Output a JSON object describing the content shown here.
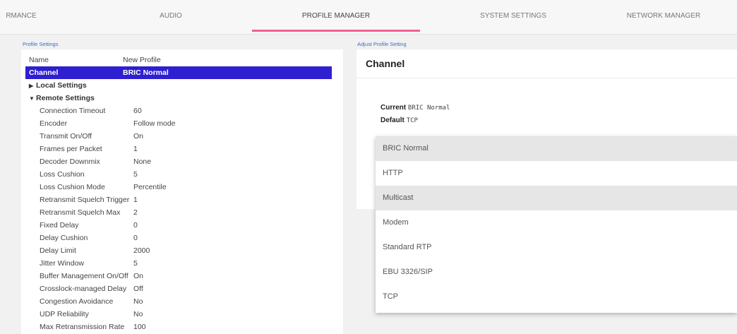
{
  "nav": {
    "tabs": [
      "RMANCE",
      "AUDIO",
      "PROFILE MANAGER",
      "SYSTEM SETTINGS",
      "NETWORK MANAGER"
    ],
    "active": "PROFILE MANAGER",
    "accent": "#f0648c"
  },
  "profile_settings": {
    "heading": "Profile Settings",
    "name_label": "Name",
    "name_value": "New Profile",
    "channel_label": "Channel",
    "channel_value": "BRIC Normal",
    "local_label": "Local Settings",
    "remote_label": "Remote Settings",
    "remote": [
      {
        "label": "Connection Timeout",
        "value": "60"
      },
      {
        "label": "Encoder",
        "value": "Follow mode"
      },
      {
        "label": "Transmit On/Off",
        "value": "On"
      },
      {
        "label": "Frames per Packet",
        "value": "1"
      },
      {
        "label": "Decoder Downmix",
        "value": "None"
      },
      {
        "label": "Loss Cushion",
        "value": "5"
      },
      {
        "label": "Loss Cushion Mode",
        "value": "Percentile"
      },
      {
        "label": "Retransmit Squelch Trigger",
        "value": "1"
      },
      {
        "label": "Retransmit Squelch Max",
        "value": "2"
      },
      {
        "label": "Fixed Delay",
        "value": "0"
      },
      {
        "label": "Delay Cushion",
        "value": "0"
      },
      {
        "label": "Delay Limit",
        "value": "2000"
      },
      {
        "label": "Jitter Window",
        "value": "5"
      },
      {
        "label": "Buffer Management On/Off",
        "value": "On"
      },
      {
        "label": "Crosslock-managed Delay",
        "value": "Off"
      },
      {
        "label": "Congestion Avoidance",
        "value": "No"
      },
      {
        "label": "UDP Reliability",
        "value": "No"
      },
      {
        "label": "Max Retransmission Rate",
        "value": "100"
      }
    ],
    "selected_color": "#2e1fd0"
  },
  "adjust": {
    "heading": "Adjust Profile Setting",
    "title": "Channel",
    "current_label": "Current",
    "current_value": "BRIC Normal",
    "default_label": "Default",
    "default_value": "TCP",
    "options": [
      "BRIC Normal",
      "HTTP",
      "Multicast",
      "Modem",
      "Standard RTP",
      "EBU 3326/SIP",
      "TCP"
    ],
    "highlighted": [
      "BRIC Normal",
      "Multicast"
    ]
  }
}
